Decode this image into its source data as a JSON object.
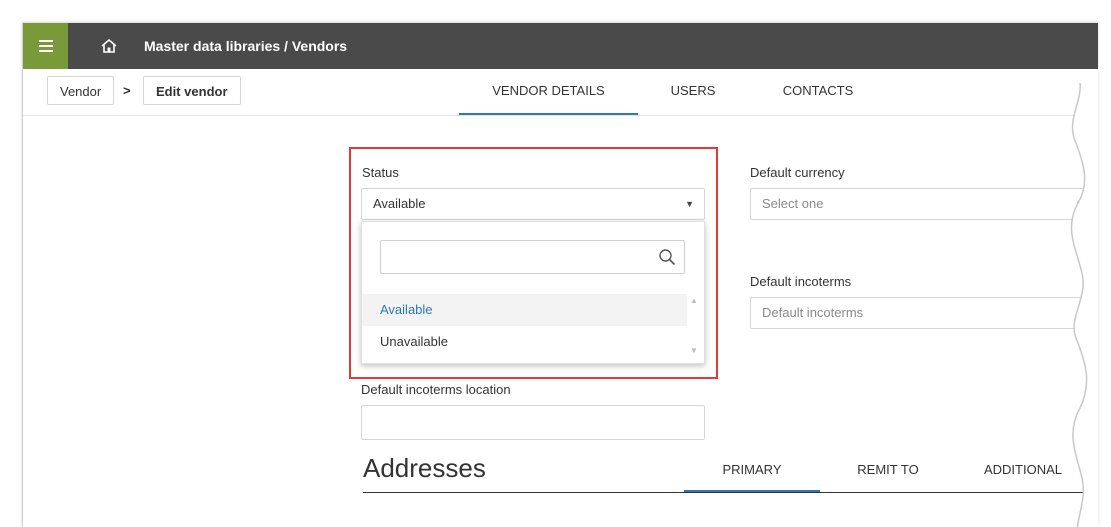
{
  "header": {
    "breadcrumb": "Master data libraries / Vendors"
  },
  "subnav": {
    "crumbs": [
      "Vendor",
      "Edit vendor"
    ],
    "separator": ">",
    "tabs": [
      "VENDOR DETAILS",
      "USERS",
      "CONTACTS"
    ],
    "active_tab": "VENDOR DETAILS"
  },
  "form": {
    "status": {
      "label": "Status",
      "value": "Available",
      "search_value": "",
      "options": [
        "Available",
        "Unavailable"
      ],
      "selected_option": "Available"
    },
    "default_currency": {
      "label": "Default currency",
      "placeholder": "Select one"
    },
    "default_incoterms": {
      "label": "Default incoterms",
      "placeholder": "Default incoterms"
    },
    "default_incoterms_location": {
      "label": "Default incoterms location",
      "value": ""
    }
  },
  "addresses": {
    "title": "Addresses",
    "tabs": [
      "PRIMARY",
      "REMIT TO",
      "ADDITIONAL"
    ],
    "active_tab": "PRIMARY"
  },
  "colors": {
    "accent": "#2b79b8",
    "topbar": "#4a4a4a",
    "menu_button": "#7a9a3a",
    "highlight": "#e03b3b"
  },
  "icons": {
    "menu": "hamburger-icon",
    "home": "home-icon",
    "search": "search-icon",
    "caret": "caret-down-icon"
  }
}
